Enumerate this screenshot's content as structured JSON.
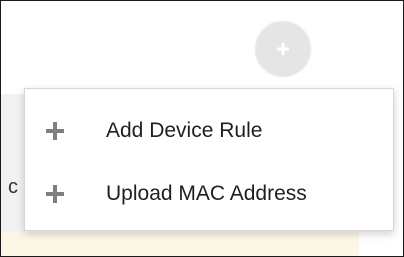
{
  "colors": {
    "menu_icon": "#7f7f7f",
    "fab_icon": "#ffffff",
    "fab_bg": "#e5e5e5",
    "text": "#1f1f1f"
  },
  "background": {
    "partial_text": "c"
  },
  "fab": {
    "icon": "plus-icon"
  },
  "menu": {
    "items": [
      {
        "label": "Add Device Rule",
        "icon": "plus-icon"
      },
      {
        "label": "Upload MAC Address",
        "icon": "plus-icon"
      }
    ]
  }
}
